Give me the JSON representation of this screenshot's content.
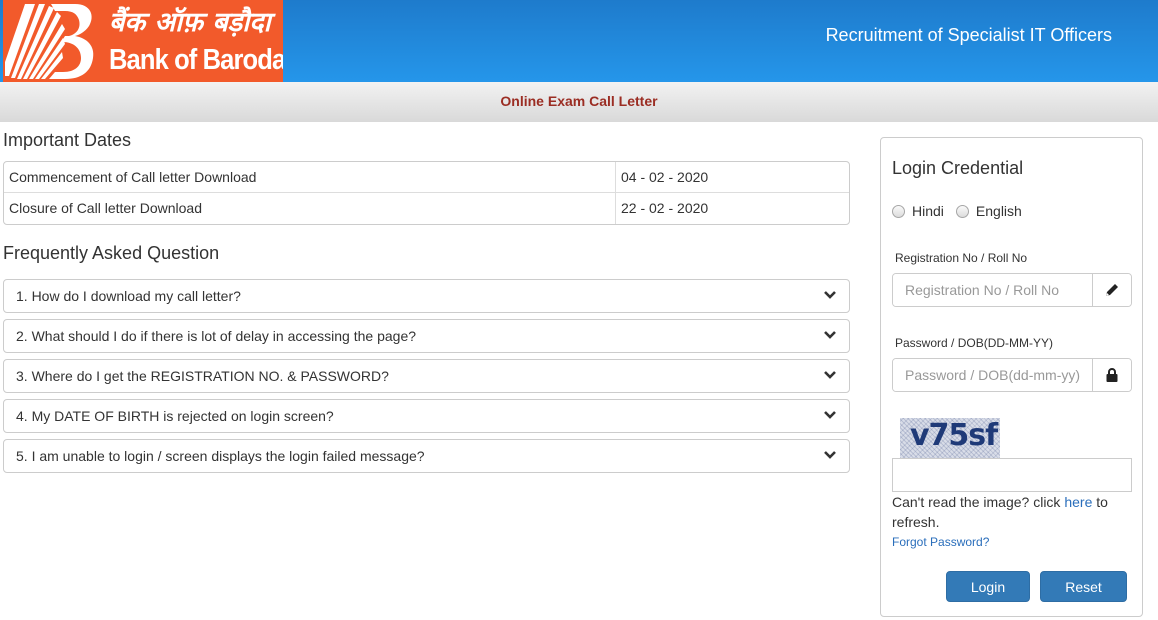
{
  "header": {
    "logo": {
      "hindi_text": "बैंक ऑफ़ बड़ौदा",
      "english_text": "Bank of Baroda",
      "brand_color": "#f25a2b"
    },
    "title": "Recruitment of Specialist IT Officers",
    "background_color": "#2596ea"
  },
  "subheader": {
    "title": "Online Exam Call Letter",
    "title_color": "#9b2d23"
  },
  "important_dates": {
    "title": "Important Dates",
    "rows": [
      {
        "label": "Commencement of Call letter Download",
        "value": "04 - 02 - 2020"
      },
      {
        "label": "Closure of Call letter Download",
        "value": "22 - 02 - 2020"
      }
    ]
  },
  "faq": {
    "title": "Frequently Asked Question",
    "items": [
      {
        "question": "1. How do I download my call letter?"
      },
      {
        "question": "2. What should I do if there is lot of delay in accessing the page?"
      },
      {
        "question": "3. Where do I get the REGISTRATION NO. & PASSWORD?"
      },
      {
        "question": "4. My DATE OF BIRTH is rejected on login screen?"
      },
      {
        "question": "5. I am unable to login / screen displays the login failed message?"
      }
    ],
    "expand_icon": "chevron-down-icon"
  },
  "login": {
    "title": "Login Credential",
    "language_options": [
      {
        "label": "Hindi",
        "selected": false
      },
      {
        "label": "English",
        "selected": false
      }
    ],
    "registration": {
      "label": "Registration No / Roll No",
      "placeholder": "Registration No / Roll No",
      "value": "",
      "icon": "pencil-icon"
    },
    "password": {
      "label": "Password / DOB(DD-MM-YY)",
      "placeholder": "Password / DOB(dd-mm-yy)",
      "value": "",
      "icon": "lock-icon"
    },
    "captcha": {
      "image_text": "v75sf",
      "input_value": "",
      "help_prefix": "Can't read the image? click ",
      "help_link": "here",
      "help_suffix": " to refresh."
    },
    "forgot_password": "Forgot Password?",
    "login_button": "Login",
    "reset_button": "Reset",
    "button_color": "#337ab7",
    "link_color": "#2a6ebb"
  }
}
